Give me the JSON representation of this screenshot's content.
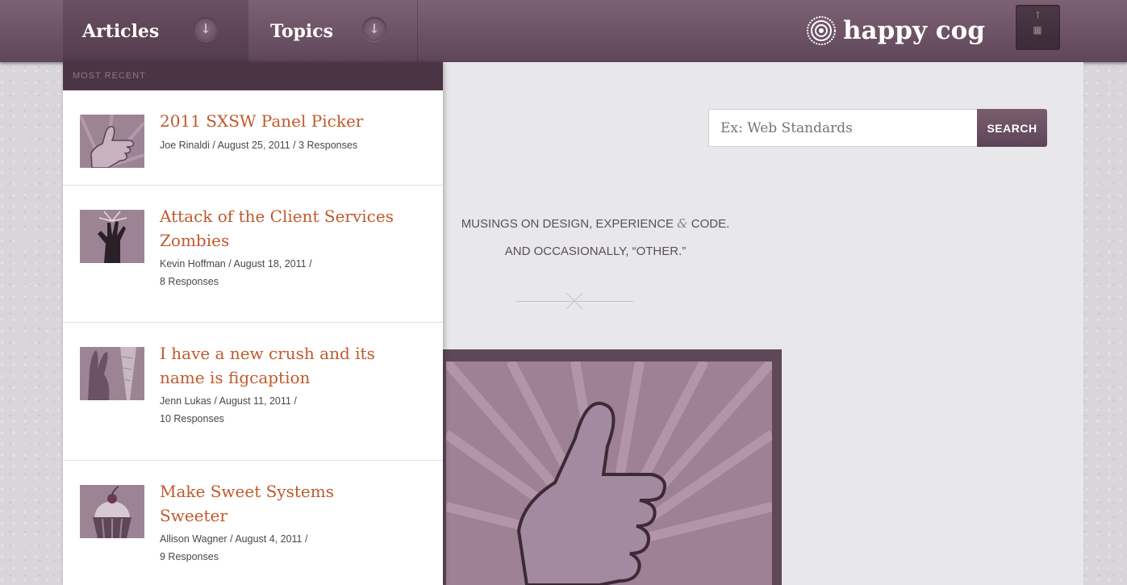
{
  "nav": {
    "tabs": [
      {
        "label": "Articles",
        "icon": "arrow-down-icon"
      },
      {
        "label": "Topics",
        "icon": "arrow-down-icon"
      }
    ],
    "brand": "happy cog",
    "grid_icon": "grid-menu-icon"
  },
  "dropdown": {
    "heading": "MOST RECENT",
    "articles": [
      {
        "title": "2011 SXSW Panel Picker",
        "meta_line1": "Joe Rinaldi / August 25, 2011 / 3 Responses",
        "meta_line2": "",
        "thumb": "thumbs-up-hand-icon"
      },
      {
        "title_line1": "Attack of the Client Services",
        "title_line2": "Zombies",
        "meta_line1": "Kevin Hoffman / August 18, 2011 /",
        "meta_line2": "8 Responses",
        "thumb": "zombie-hand-icon"
      },
      {
        "title_line1": "I have a new crush and its",
        "title_line2": "name is figcaption",
        "meta_line1": "Jenn Lukas / August 11, 2011 /",
        "meta_line2": "10 Responses",
        "thumb": "rabbit-carrot-icon"
      },
      {
        "title_line1": "Make Sweet Systems",
        "title_line2": "Sweeter",
        "meta_line1": "Allison Wagner / August 4, 2011 /",
        "meta_line2": "9 Responses",
        "thumb": "cupcake-icon"
      }
    ]
  },
  "search": {
    "placeholder": "Ex: Web Standards",
    "button_label": "SEARCH"
  },
  "tagline": {
    "line1_a": "MUSINGS ON DESIGN, EXPERIENCE",
    "line1_amp": "&",
    "line1_b": "CODE.",
    "line2": "AND OCCASIONALLY, “OTHER.”"
  },
  "colors": {
    "nav_bg": "#6e5466",
    "accent_title": "#c1592c",
    "hero_bg": "#5e4858"
  }
}
